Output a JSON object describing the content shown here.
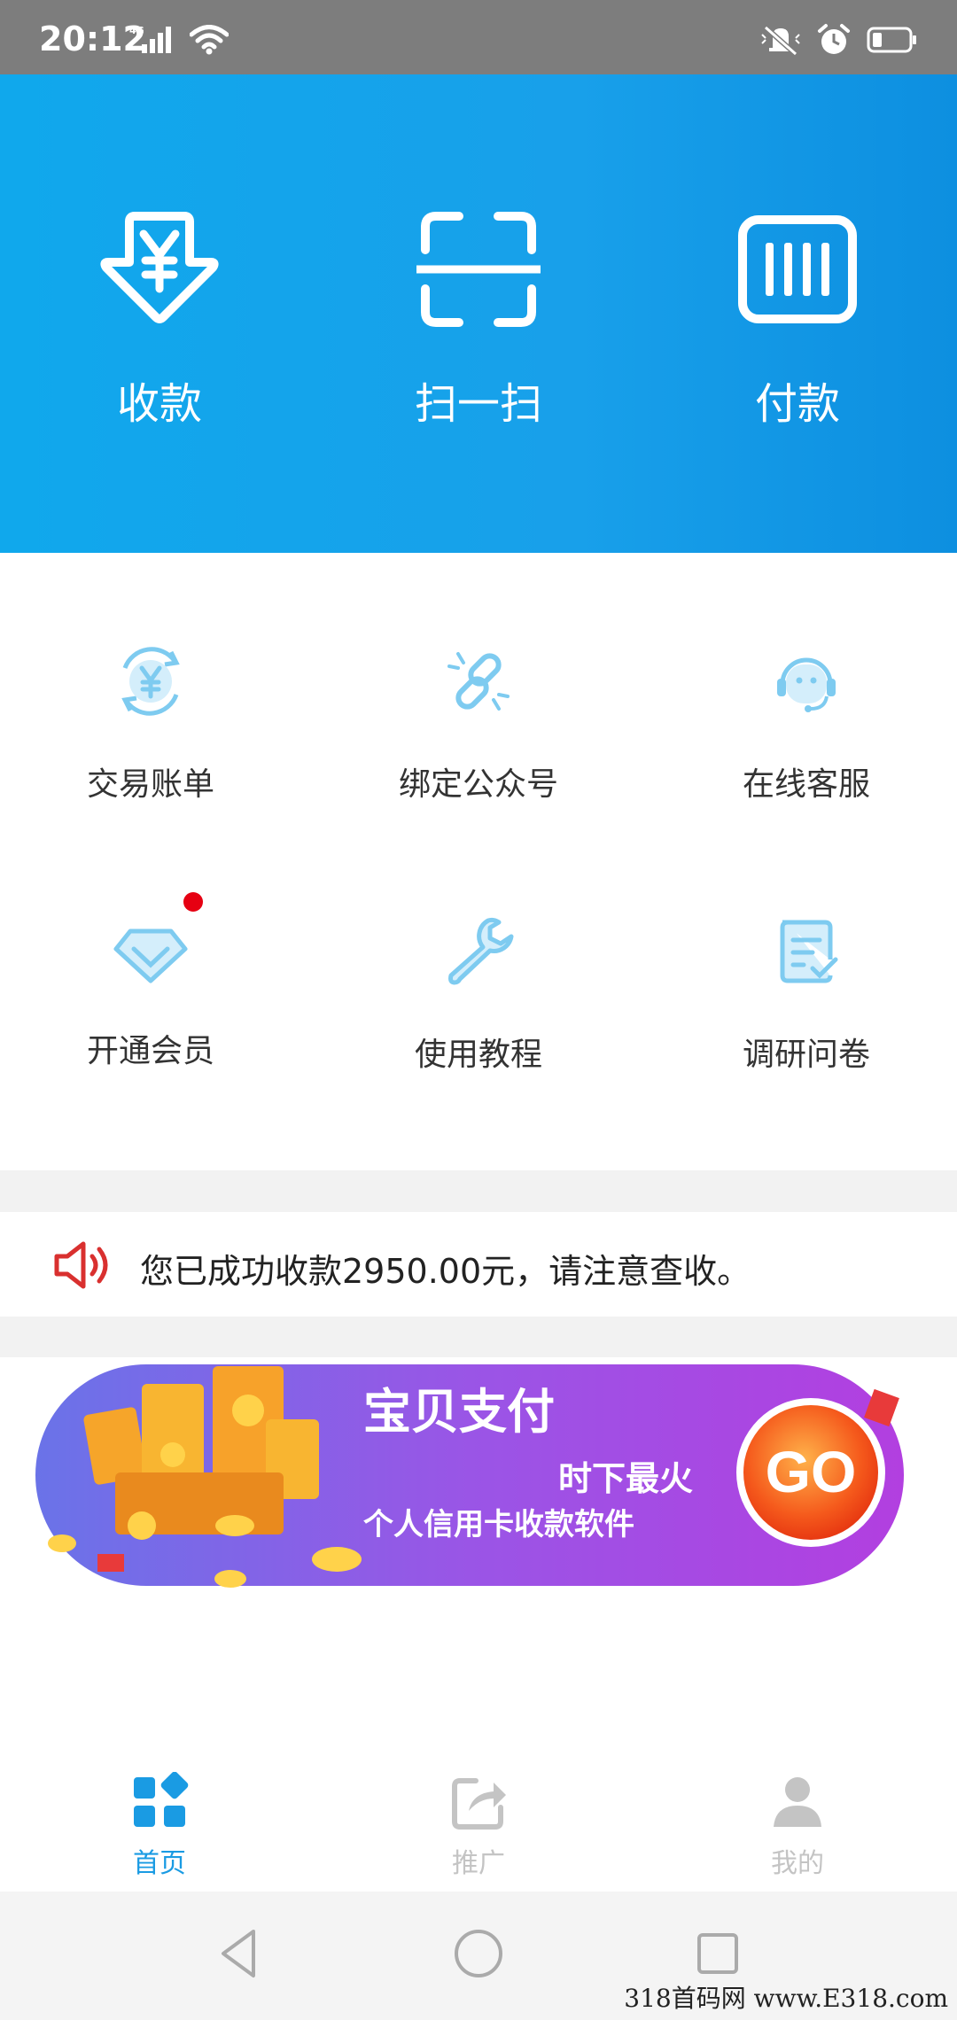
{
  "status_bar": {
    "time": "20:12",
    "network": "4G"
  },
  "hero": {
    "receive_label": "收款",
    "scan_label": "扫一扫",
    "pay_label": "付款"
  },
  "grid": {
    "items": [
      {
        "label": "交易账单",
        "icon": "bill-yen-icon"
      },
      {
        "label": "绑定公众号",
        "icon": "link-icon"
      },
      {
        "label": "在线客服",
        "icon": "headset-icon"
      },
      {
        "label": "开通会员",
        "icon": "diamond-icon"
      },
      {
        "label": "使用教程",
        "icon": "wrench-icon"
      },
      {
        "label": "调研问卷",
        "icon": "survey-icon"
      }
    ]
  },
  "notice": {
    "text": "您已成功收款2950.00元，请注意查收。"
  },
  "banner": {
    "title": "宝贝支付",
    "subtitle": "时下最火",
    "tagline": "个人信用卡收款软件",
    "go_label": "GO"
  },
  "bottom_nav": {
    "items": [
      {
        "label": "首页",
        "active": true
      },
      {
        "label": "推广",
        "active": false
      },
      {
        "label": "我的",
        "active": false
      }
    ]
  },
  "watermark": "318首码网 www.E318.com",
  "colors": {
    "hero_blue": "#10a8ec",
    "icon_blue": "#7ecbf0",
    "active_tab": "#1a9be3",
    "inactive_tab": "#c4c4c4",
    "red_dot": "#e60012",
    "speaker_red": "#d9302f"
  }
}
